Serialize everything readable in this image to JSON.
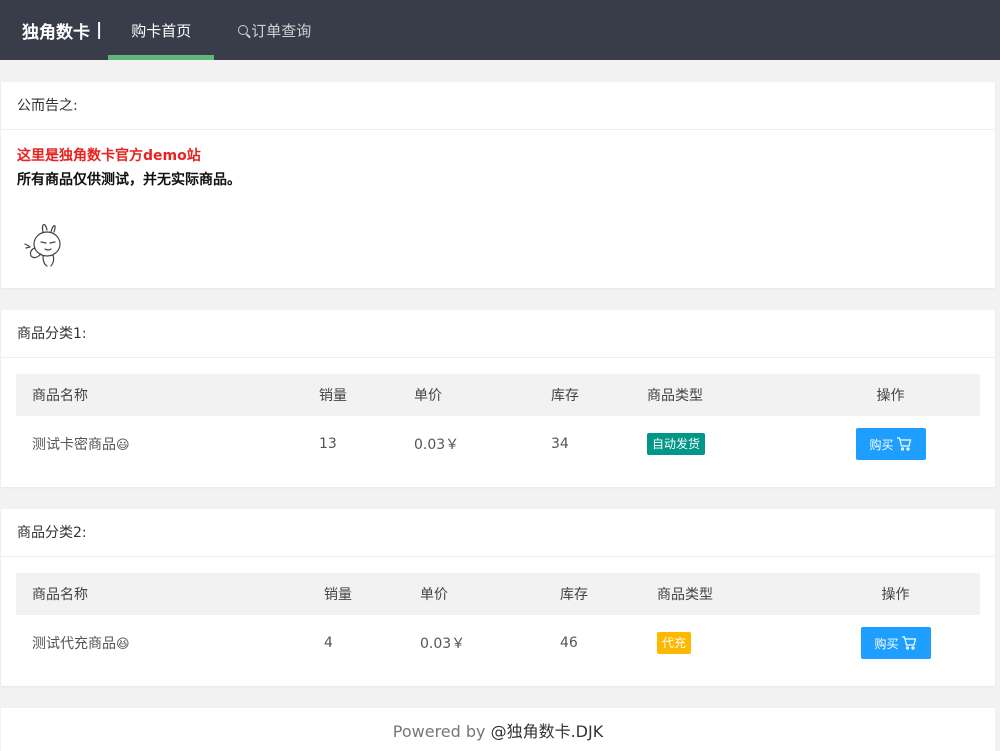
{
  "nav": {
    "brand": "独角数卡",
    "separator": "|",
    "home": "购卡首页",
    "order_query": "订单查询"
  },
  "notice": {
    "title": "公而告之:",
    "line1": "这里是独角数卡官方demo站",
    "line2": "所有商品仅供测试，并无实际商品。"
  },
  "categories": [
    {
      "title": "商品分类1:",
      "headers": {
        "name": "商品名称",
        "sales": "销量",
        "price": "单价",
        "stock": "库存",
        "type": "商品类型",
        "action": "操作"
      },
      "rows": [
        {
          "name": "测试卡密商品",
          "emoji": "😃",
          "sales": "13",
          "price": "0.03￥",
          "stock": "34",
          "type": "自动发货",
          "type_color": "#009688",
          "buy": "购买"
        }
      ]
    },
    {
      "title": "商品分类2:",
      "headers": {
        "name": "商品名称",
        "sales": "销量",
        "price": "单价",
        "stock": "库存",
        "type": "商品类型",
        "action": "操作"
      },
      "rows": [
        {
          "name": "测试代充商品",
          "emoji": "😆",
          "sales": "4",
          "price": "0.03￥",
          "stock": "46",
          "type": "代充",
          "type_color": "#ffb800",
          "buy": "购买"
        }
      ]
    }
  ],
  "footer": {
    "prefix": "Powered by ",
    "author": "@独角数卡.DJK"
  },
  "colors": {
    "nav_bg": "#393d49",
    "nav_active": "#5fb878",
    "notice_red": "#e8221f",
    "buy_blue": "#1e9fff"
  }
}
